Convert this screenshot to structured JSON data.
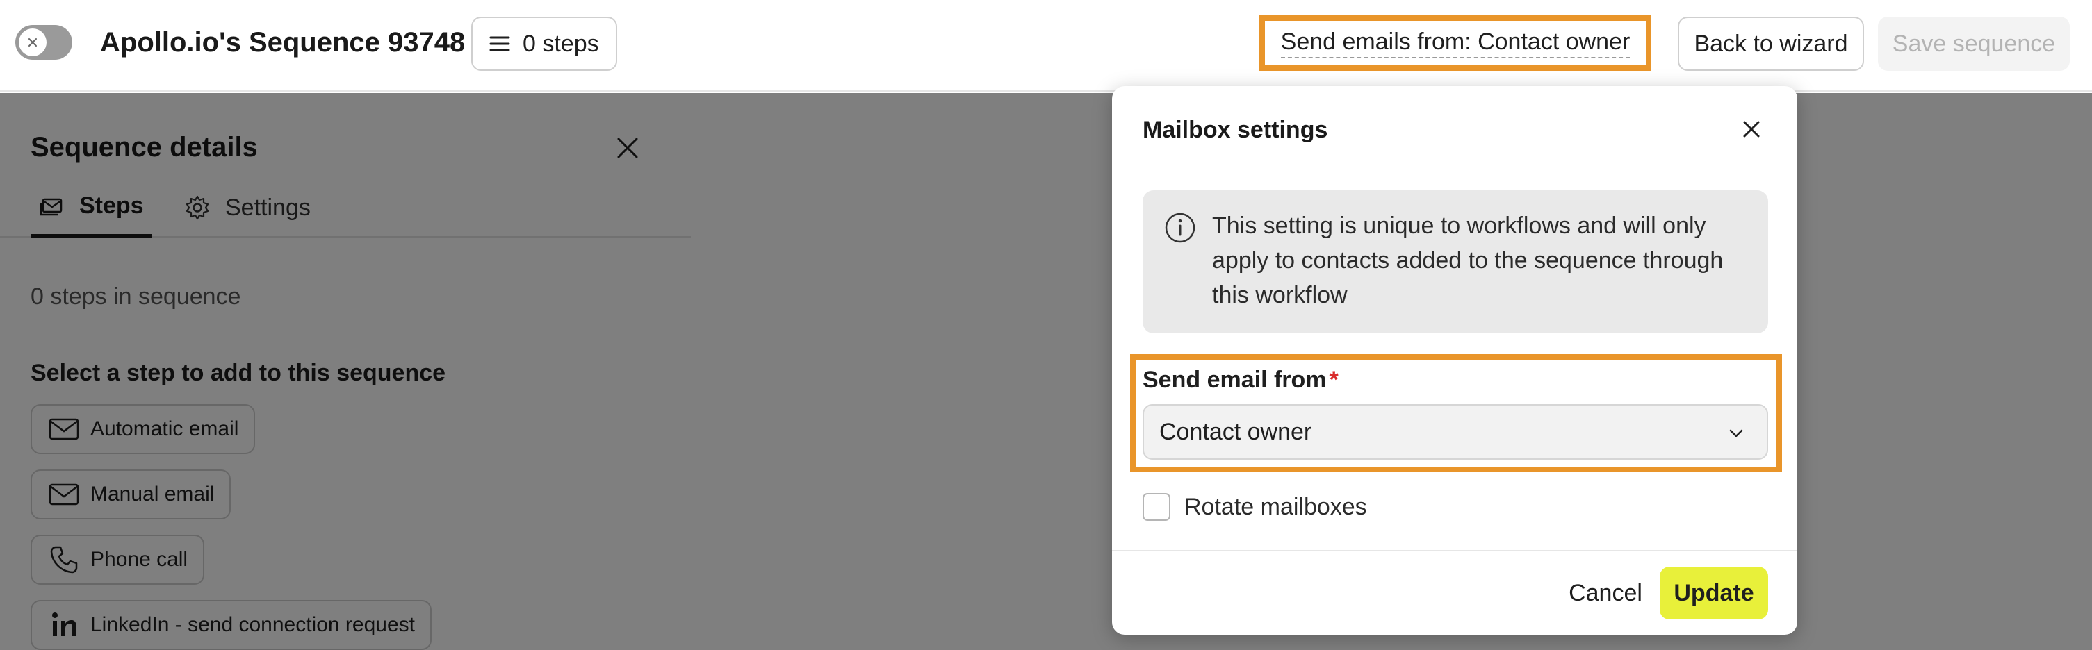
{
  "header": {
    "title": "Apollo.io's Sequence 93748",
    "steps_button": "0 steps",
    "send_emails_from": "Send emails from: Contact owner",
    "back_button": "Back to wizard",
    "save_button": "Save sequence"
  },
  "left_panel": {
    "title": "Sequence details",
    "tabs": [
      {
        "label": "Steps",
        "icon": "steps-icon",
        "active": true
      },
      {
        "label": "Settings",
        "icon": "gear-icon",
        "active": false
      }
    ],
    "steps_count": "0 steps in sequence",
    "select_label": "Select a step to add to this sequence",
    "step_types": [
      {
        "label": "Automatic email",
        "icon": "mail-icon"
      },
      {
        "label": "Manual email",
        "icon": "mail-icon"
      },
      {
        "label": "Phone call",
        "icon": "phone-icon"
      },
      {
        "label": "LinkedIn - send connection request",
        "icon": "linkedin-icon"
      }
    ]
  },
  "modal": {
    "title": "Mailbox settings",
    "info_text": "This setting is unique to workflows and will only apply to contacts added to the sequence through this workflow",
    "field_label": "Send email from",
    "required_mark": "*",
    "selected_value": "Contact owner",
    "checkbox_label": "Rotate mailboxes",
    "checkbox_checked": false,
    "cancel_button": "Cancel",
    "update_button": "Update"
  },
  "colors": {
    "highlight": "#e9952a",
    "update_button": "#e8f03a",
    "required": "#d92c2c"
  }
}
